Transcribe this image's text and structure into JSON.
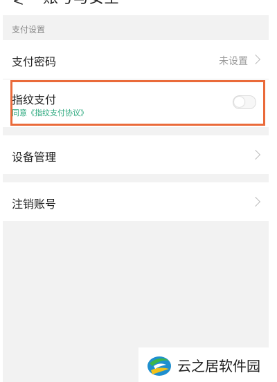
{
  "header": {
    "title": "账号与安全"
  },
  "section": {
    "label": "支付设置"
  },
  "rows": {
    "payment_password": {
      "label": "支付密码",
      "value": "未设置"
    },
    "fingerprint": {
      "label": "指纹支付",
      "agreement": "同意《指纹支付协议》",
      "enabled": false
    },
    "device_management": {
      "label": "设备管理"
    },
    "cancel_account": {
      "label": "注销账号"
    }
  },
  "colors": {
    "highlight": "#ea6a3a",
    "agreement_text": "#2aa87d",
    "background": "#f2f2f2"
  },
  "watermark": {
    "text": "云之居软件园"
  }
}
